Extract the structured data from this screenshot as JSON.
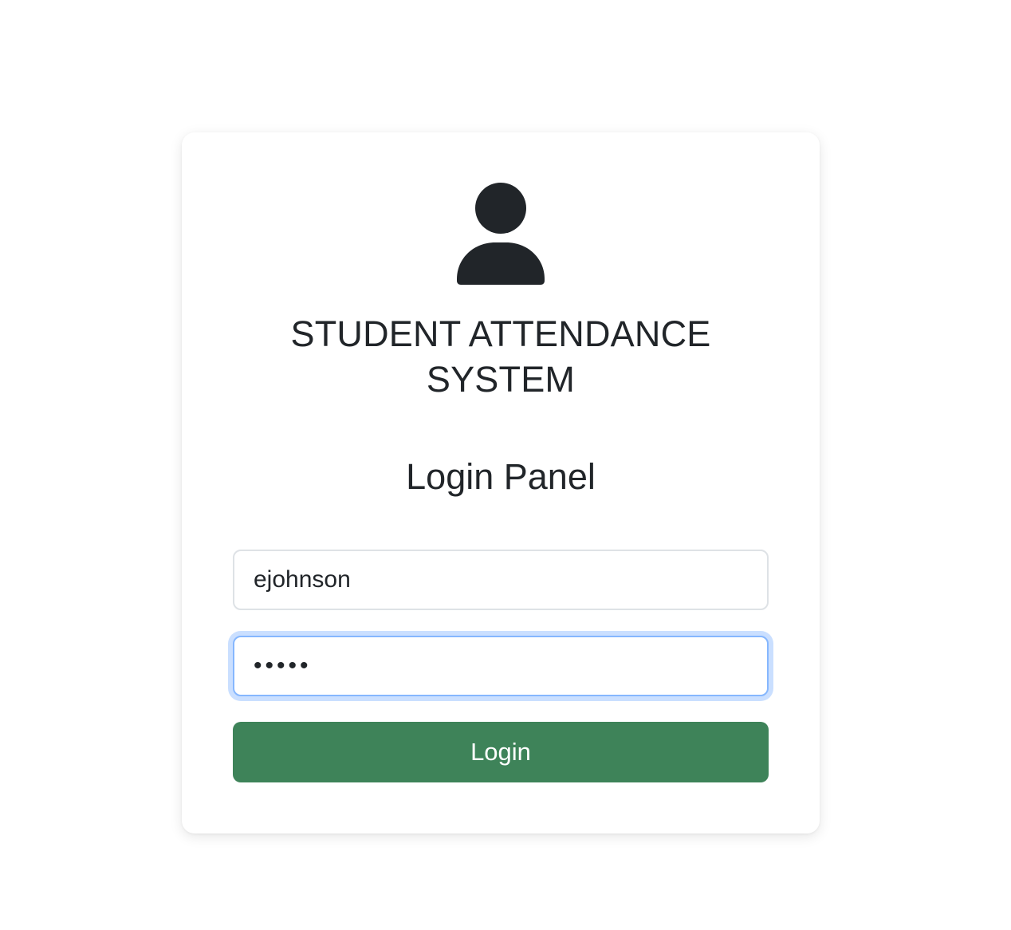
{
  "app": {
    "title_line1": "STUDENT ATTENDANCE",
    "title_line2": "SYSTEM"
  },
  "login_panel": {
    "heading": "Login Panel",
    "avatar_icon": "user-icon",
    "username": {
      "value": "ejohnson"
    },
    "password": {
      "value": "•••••",
      "focused": true
    },
    "submit_label": "Login"
  },
  "colors": {
    "button": "#3e8359",
    "text": "#212529",
    "focus_ring": "#86b7fe"
  }
}
